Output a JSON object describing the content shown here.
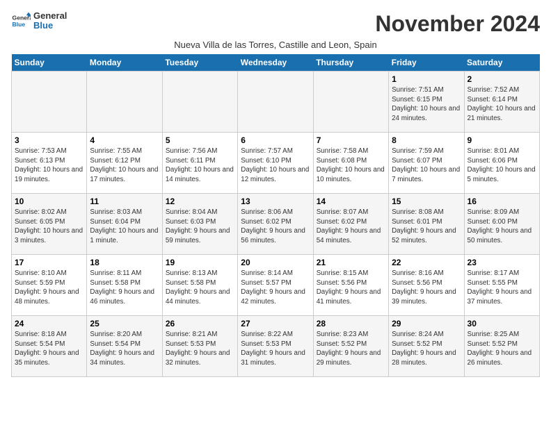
{
  "header": {
    "logo_general": "General",
    "logo_blue": "Blue",
    "month_title": "November 2024",
    "subtitle": "Nueva Villa de las Torres, Castille and Leon, Spain"
  },
  "weekdays": [
    "Sunday",
    "Monday",
    "Tuesday",
    "Wednesday",
    "Thursday",
    "Friday",
    "Saturday"
  ],
  "weeks": [
    [
      {
        "day": "",
        "info": ""
      },
      {
        "day": "",
        "info": ""
      },
      {
        "day": "",
        "info": ""
      },
      {
        "day": "",
        "info": ""
      },
      {
        "day": "",
        "info": ""
      },
      {
        "day": "1",
        "info": "Sunrise: 7:51 AM\nSunset: 6:15 PM\nDaylight: 10 hours and 24 minutes."
      },
      {
        "day": "2",
        "info": "Sunrise: 7:52 AM\nSunset: 6:14 PM\nDaylight: 10 hours and 21 minutes."
      }
    ],
    [
      {
        "day": "3",
        "info": "Sunrise: 7:53 AM\nSunset: 6:13 PM\nDaylight: 10 hours and 19 minutes."
      },
      {
        "day": "4",
        "info": "Sunrise: 7:55 AM\nSunset: 6:12 PM\nDaylight: 10 hours and 17 minutes."
      },
      {
        "day": "5",
        "info": "Sunrise: 7:56 AM\nSunset: 6:11 PM\nDaylight: 10 hours and 14 minutes."
      },
      {
        "day": "6",
        "info": "Sunrise: 7:57 AM\nSunset: 6:10 PM\nDaylight: 10 hours and 12 minutes."
      },
      {
        "day": "7",
        "info": "Sunrise: 7:58 AM\nSunset: 6:08 PM\nDaylight: 10 hours and 10 minutes."
      },
      {
        "day": "8",
        "info": "Sunrise: 7:59 AM\nSunset: 6:07 PM\nDaylight: 10 hours and 7 minutes."
      },
      {
        "day": "9",
        "info": "Sunrise: 8:01 AM\nSunset: 6:06 PM\nDaylight: 10 hours and 5 minutes."
      }
    ],
    [
      {
        "day": "10",
        "info": "Sunrise: 8:02 AM\nSunset: 6:05 PM\nDaylight: 10 hours and 3 minutes."
      },
      {
        "day": "11",
        "info": "Sunrise: 8:03 AM\nSunset: 6:04 PM\nDaylight: 10 hours and 1 minute."
      },
      {
        "day": "12",
        "info": "Sunrise: 8:04 AM\nSunset: 6:03 PM\nDaylight: 9 hours and 59 minutes."
      },
      {
        "day": "13",
        "info": "Sunrise: 8:06 AM\nSunset: 6:02 PM\nDaylight: 9 hours and 56 minutes."
      },
      {
        "day": "14",
        "info": "Sunrise: 8:07 AM\nSunset: 6:02 PM\nDaylight: 9 hours and 54 minutes."
      },
      {
        "day": "15",
        "info": "Sunrise: 8:08 AM\nSunset: 6:01 PM\nDaylight: 9 hours and 52 minutes."
      },
      {
        "day": "16",
        "info": "Sunrise: 8:09 AM\nSunset: 6:00 PM\nDaylight: 9 hours and 50 minutes."
      }
    ],
    [
      {
        "day": "17",
        "info": "Sunrise: 8:10 AM\nSunset: 5:59 PM\nDaylight: 9 hours and 48 minutes."
      },
      {
        "day": "18",
        "info": "Sunrise: 8:11 AM\nSunset: 5:58 PM\nDaylight: 9 hours and 46 minutes."
      },
      {
        "day": "19",
        "info": "Sunrise: 8:13 AM\nSunset: 5:58 PM\nDaylight: 9 hours and 44 minutes."
      },
      {
        "day": "20",
        "info": "Sunrise: 8:14 AM\nSunset: 5:57 PM\nDaylight: 9 hours and 42 minutes."
      },
      {
        "day": "21",
        "info": "Sunrise: 8:15 AM\nSunset: 5:56 PM\nDaylight: 9 hours and 41 minutes."
      },
      {
        "day": "22",
        "info": "Sunrise: 8:16 AM\nSunset: 5:56 PM\nDaylight: 9 hours and 39 minutes."
      },
      {
        "day": "23",
        "info": "Sunrise: 8:17 AM\nSunset: 5:55 PM\nDaylight: 9 hours and 37 minutes."
      }
    ],
    [
      {
        "day": "24",
        "info": "Sunrise: 8:18 AM\nSunset: 5:54 PM\nDaylight: 9 hours and 35 minutes."
      },
      {
        "day": "25",
        "info": "Sunrise: 8:20 AM\nSunset: 5:54 PM\nDaylight: 9 hours and 34 minutes."
      },
      {
        "day": "26",
        "info": "Sunrise: 8:21 AM\nSunset: 5:53 PM\nDaylight: 9 hours and 32 minutes."
      },
      {
        "day": "27",
        "info": "Sunrise: 8:22 AM\nSunset: 5:53 PM\nDaylight: 9 hours and 31 minutes."
      },
      {
        "day": "28",
        "info": "Sunrise: 8:23 AM\nSunset: 5:52 PM\nDaylight: 9 hours and 29 minutes."
      },
      {
        "day": "29",
        "info": "Sunrise: 8:24 AM\nSunset: 5:52 PM\nDaylight: 9 hours and 28 minutes."
      },
      {
        "day": "30",
        "info": "Sunrise: 8:25 AM\nSunset: 5:52 PM\nDaylight: 9 hours and 26 minutes."
      }
    ]
  ]
}
